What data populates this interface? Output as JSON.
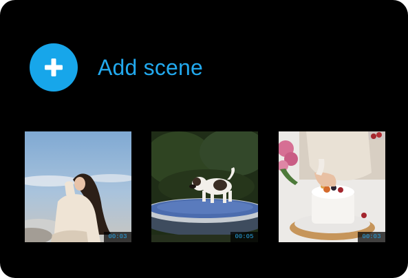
{
  "add_scene": {
    "label": "Add scene",
    "icon": "plus-icon",
    "accent_color": "#17a6ea"
  },
  "scenes": [
    {
      "duration": "00:03",
      "subject": "woman-sitting-at-sky"
    },
    {
      "duration": "00:05",
      "subject": "dog-on-trampoline"
    },
    {
      "duration": "00:03",
      "subject": "hands-decorating-cake"
    }
  ]
}
